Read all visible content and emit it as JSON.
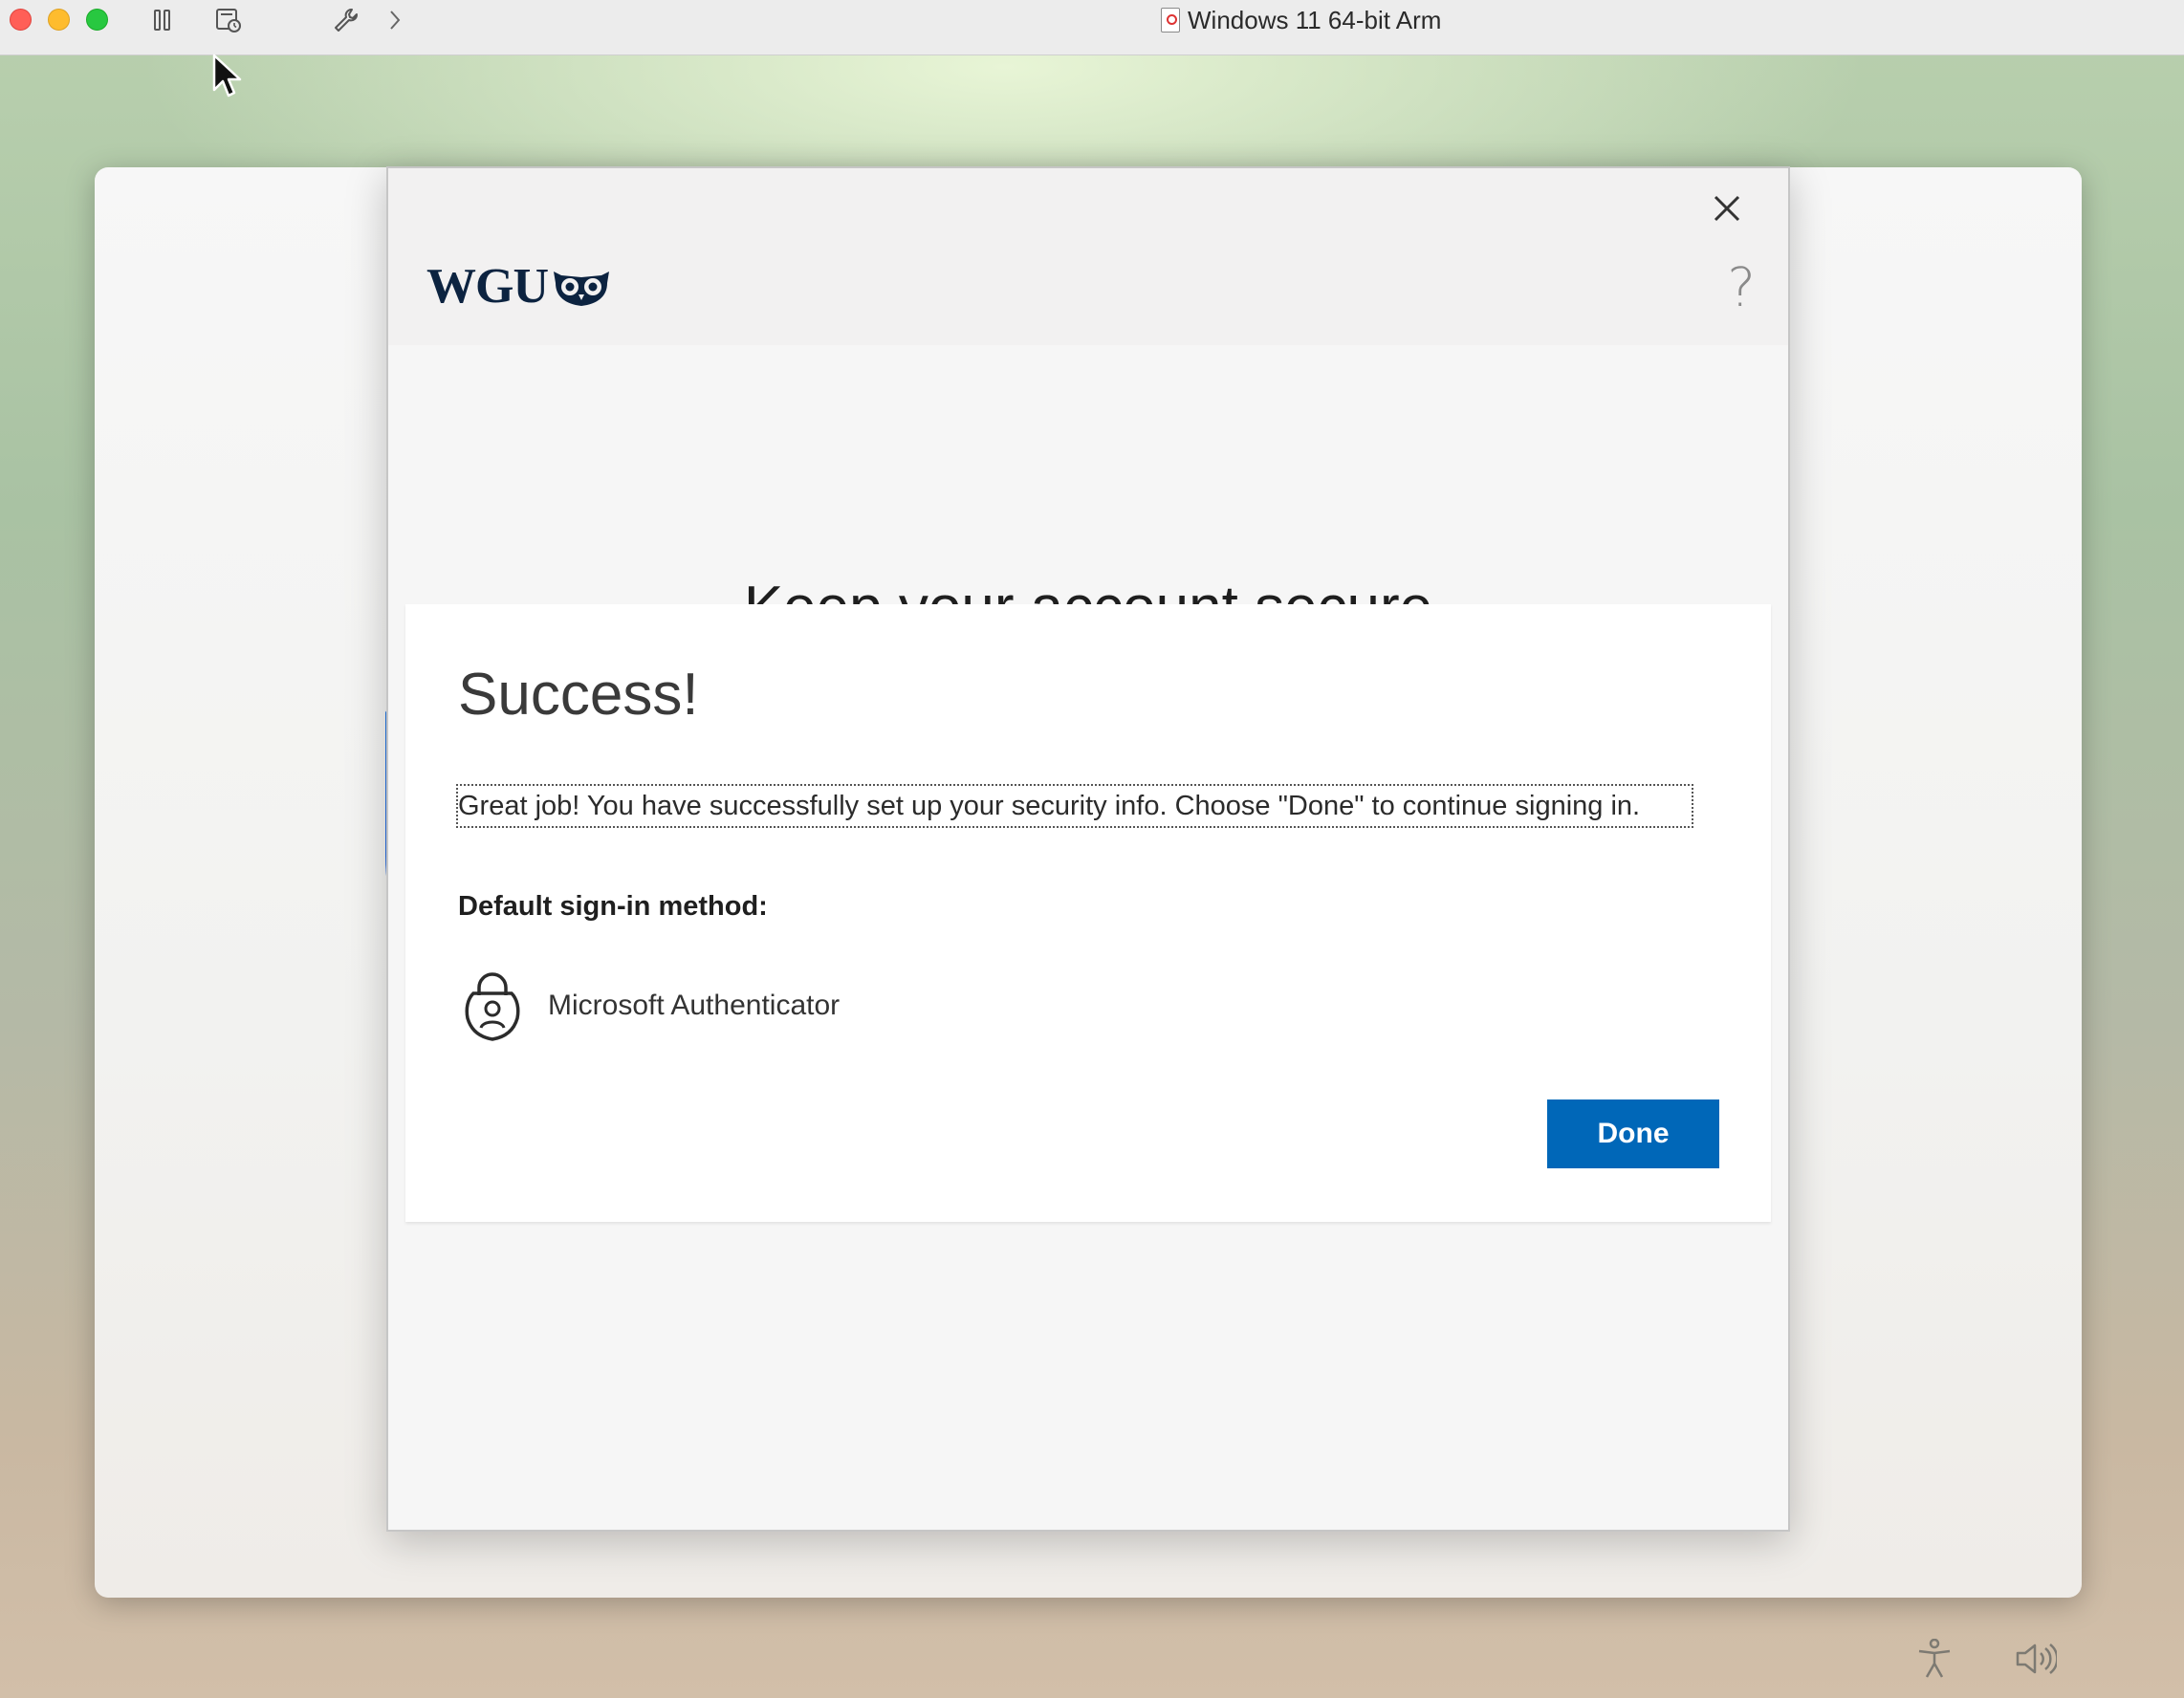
{
  "host_window": {
    "title": "Windows 11 64-bit Arm",
    "toolbar_icons": [
      "pause-icon",
      "snapshot-icon",
      "wrench-icon",
      "chevron-right-icon"
    ]
  },
  "dialog": {
    "logo_text": "WGU",
    "heading": "Keep your account secure",
    "card": {
      "title": "Success!",
      "message": "Great job! You have successfully set up your security info. Choose \"Done\" to continue signing in.",
      "default_method_label": "Default sign-in method:",
      "method_name": "Microsoft Authenticator",
      "done_label": "Done"
    }
  },
  "colors": {
    "primary_button": "#0067b8",
    "logo": "#0c2340"
  },
  "bottom_icons": [
    "accessibility-icon",
    "volume-icon"
  ]
}
